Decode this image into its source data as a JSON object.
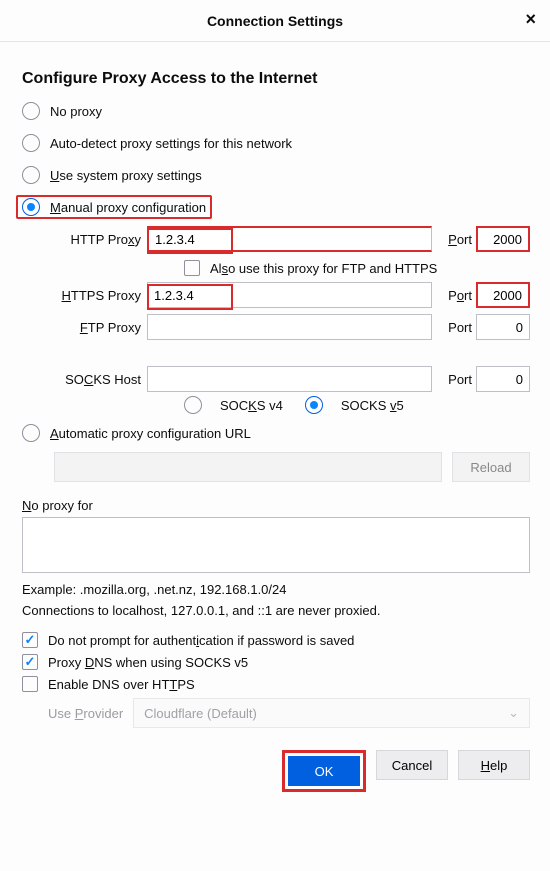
{
  "title": "Connection Settings",
  "heading": "Configure Proxy Access to the Internet",
  "radios": {
    "no_proxy": "No proxy",
    "auto_detect": "Auto-detect proxy settings for this network",
    "system": "Use system proxy settings",
    "manual": "Manual proxy configuration",
    "pac": "Automatic proxy configuration URL",
    "selected": "manual"
  },
  "fields": {
    "http_label": "HTTP Proxy",
    "http_host": "1.2.3.4",
    "http_port": "2000",
    "use_for_all": "Also use this proxy for FTP and HTTPS",
    "use_for_all_checked": false,
    "https_label": "HTTPS Proxy",
    "https_host": "1.2.3.4",
    "https_port": "2000",
    "ftp_label": "FTP Proxy",
    "ftp_host": "",
    "ftp_port": "0",
    "socks_label": "SOCKS Host",
    "socks_host": "",
    "socks_port": "0",
    "port_label": "Port",
    "socks_v4": "SOCKS v4",
    "socks_v5": "SOCKS v5",
    "socks_version": "v5"
  },
  "pac": {
    "url": "",
    "reload": "Reload"
  },
  "noproxy": {
    "label": "No proxy for",
    "value": "",
    "example": "Example: .mozilla.org, .net.nz, 192.168.1.0/24",
    "localhost_note": "Connections to localhost, 127.0.0.1, and ::1 are never proxied."
  },
  "checks": {
    "no_prompt_auth": "Do not prompt for authentication if password is saved",
    "no_prompt_auth_checked": true,
    "proxy_dns_socks5": "Proxy DNS when using SOCKS v5",
    "proxy_dns_socks5_checked": true,
    "enable_doh": "Enable DNS over HTTPS",
    "enable_doh_checked": false
  },
  "provider": {
    "label": "Use Provider",
    "value": "Cloudflare (Default)"
  },
  "buttons": {
    "ok": "OK",
    "cancel": "Cancel",
    "help": "Help"
  }
}
